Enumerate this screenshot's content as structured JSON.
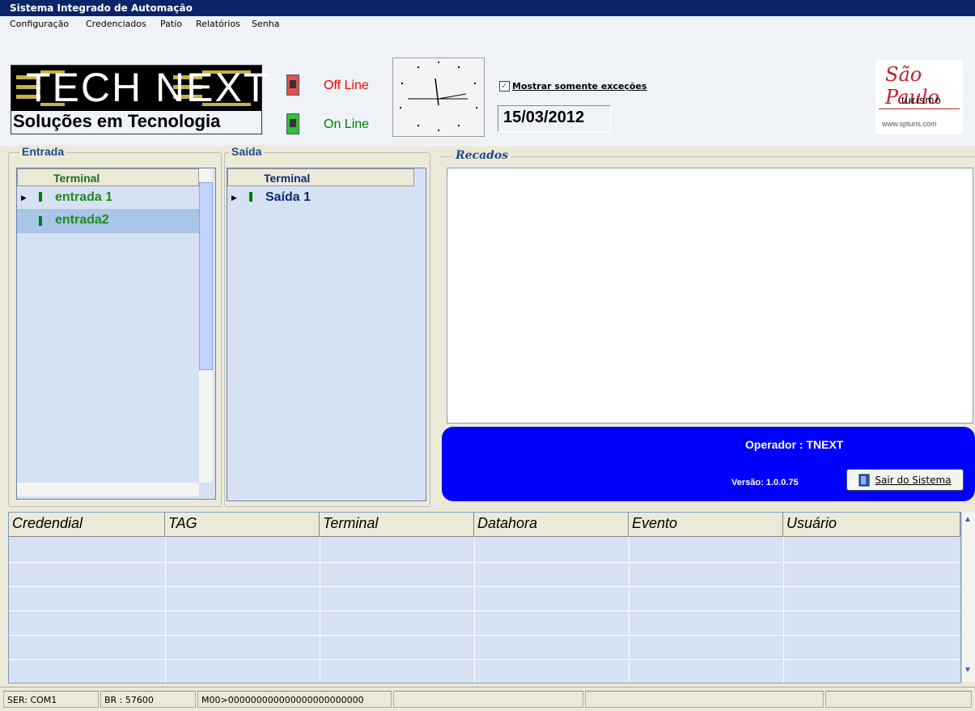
{
  "window": {
    "title": "Sistema Integrado de Automação"
  },
  "menu": {
    "items": [
      "Configuração",
      "Credenciados",
      "Patio",
      "Relatórios",
      "Senha"
    ]
  },
  "logo": {
    "line1": "TECH NEXT",
    "line2": "Soluções em Tecnologia"
  },
  "status": {
    "offline": "Off Line",
    "online": "On Line",
    "offline_color": "#FF0000",
    "online_color": "#008000"
  },
  "exceptions": {
    "label": "Mostrar somente exceções",
    "checked": true
  },
  "date": "15/03/2012",
  "brand": {
    "line1": "São Paulo",
    "line2": "turismo",
    "line3": "www.spturis.com"
  },
  "entrada": {
    "label": "Entrada",
    "header": "Terminal",
    "rows": [
      "entrada 1",
      "entrada2"
    ]
  },
  "saida": {
    "label": "Saída",
    "header": "Terminal",
    "rows": [
      "Saída 1"
    ]
  },
  "recados": {
    "label": "Recados"
  },
  "operator": {
    "label": "Operador :",
    "name": "TNEXT",
    "version": "Versão: 1.0.0.75",
    "exit_button": "Sair do Sistema"
  },
  "events_grid": {
    "columns": [
      "Credendial",
      "TAG",
      "Terminal",
      "Datahora",
      "Evento",
      "Usuário"
    ]
  },
  "statusbar": {
    "port": "SER: COM1",
    "baud": "BR : 57600",
    "message": "M00>000000000000000000000000"
  }
}
